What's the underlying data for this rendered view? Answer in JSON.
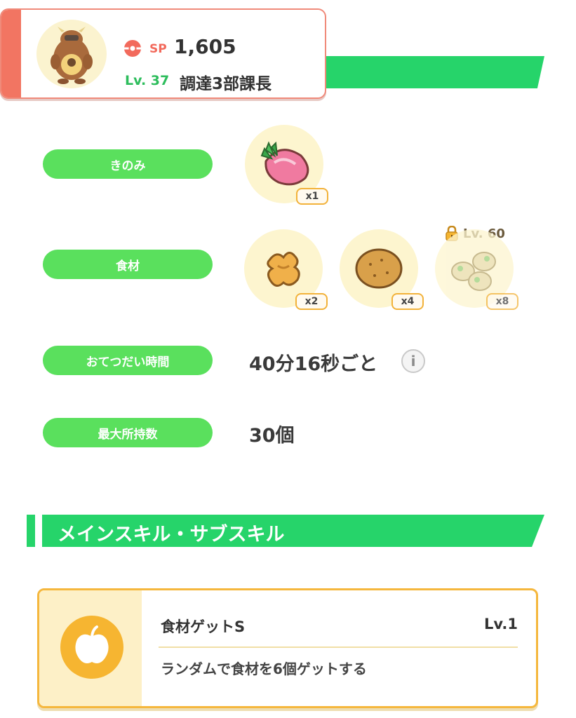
{
  "profile": {
    "sp_label": "SP",
    "sp_value": "1,605",
    "level": "Lv. 37",
    "nickname": "調達3部課長",
    "accent_color": "#f27562"
  },
  "rows": {
    "berry_label": "きのみ",
    "berry_qty": "x1",
    "ingredient_label": "食材",
    "ingredient_qtys": [
      "x2",
      "x4",
      "x8"
    ],
    "ingredient_lock_level": "Lv. 60",
    "help_time_label": "おてつだい時間",
    "help_time_value": "40分16秒ごと",
    "carry_label": "最大所持数",
    "carry_value": "30個"
  },
  "skills": {
    "section_title": "メインスキル・サブスキル",
    "main_skill_name": "食材ゲットS",
    "main_skill_level": "Lv.1",
    "main_skill_desc": "ランダムで食材を6個ゲットする"
  },
  "icons": {
    "sp": "pokeball-icon",
    "berry": "pink-radish-berry-icon",
    "ingredient_1": "ginger-icon",
    "ingredient_2": "potato-icon",
    "ingredient_3": "soybean-icon",
    "lock": "padlock-icon",
    "info": "info-icon",
    "skill": "apple-icon"
  },
  "colors": {
    "green": "#26d46a",
    "pill_green": "#5ae05d",
    "gold": "#f5b73d"
  }
}
